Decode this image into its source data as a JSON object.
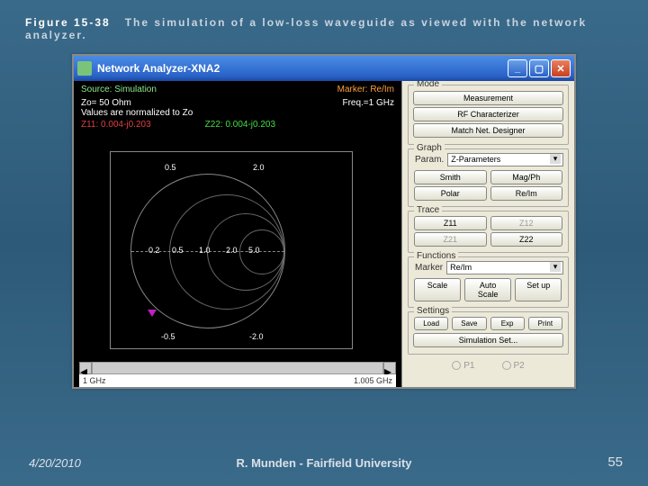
{
  "caption": {
    "num": "Figure 15-38",
    "text": "The simulation of a low-loss waveguide as viewed with the network analyzer."
  },
  "window": {
    "title": "Network Analyzer-XNA2",
    "min": "_",
    "max": "▢",
    "close": "✕"
  },
  "plot": {
    "source": "Source: Simulation",
    "marker_label": "Marker: Re/Im",
    "zo": "Zo= 50 Ohm",
    "freq": "Freq.=1 GHz",
    "normalized": "Values are normalized to Zo",
    "z11": "Z11: 0.004-j0.203",
    "z22": "Z22: 0.004-j0.203",
    "ticks": {
      "top_left": "0.5",
      "top_right": "2.0",
      "mid_02": "0.2",
      "mid_05": "0.5",
      "mid_10": "1.0",
      "mid_20": "2.0",
      "mid_50": "5.0",
      "bot_left": "-0.5",
      "bot_right": "-2.0"
    },
    "freq_start": "1 GHz",
    "freq_end": "1.005 GHz"
  },
  "panel": {
    "mode": {
      "title": "Mode",
      "measurement": "Measurement",
      "rf": "RF Characterizer",
      "match": "Match Net. Designer"
    },
    "graph": {
      "title": "Graph",
      "param_label": "Param.",
      "param_value": "Z-Parameters",
      "smith": "Smith",
      "magph": "Mag/Ph",
      "polar": "Polar",
      "reim": "Re/Im"
    },
    "trace": {
      "title": "Trace",
      "z11": "Z11",
      "z12": "Z12",
      "z21": "Z21",
      "z22": "Z22"
    },
    "functions": {
      "title": "Functions",
      "marker_label": "Marker",
      "marker_value": "Re/Im",
      "scale": "Scale",
      "auto": "Auto Scale",
      "setup": "Set up"
    },
    "settings": {
      "title": "Settings",
      "load": "Load",
      "save": "Save",
      "exp": "Exp",
      "print": "Print",
      "sim": "Simulation Set..."
    },
    "ports": {
      "p1": "P1",
      "p2": "P2"
    }
  },
  "footer": {
    "date": "4/20/2010",
    "author": "R. Munden - Fairfield University",
    "page": "55"
  },
  "chart_data": {
    "type": "smith",
    "title": "Smith chart (Z-parameters, normalized to 50 Ω)",
    "reference_impedance_ohm": 50,
    "frequency_GHz": 1.0,
    "sweep_GHz": [
      1.0,
      1.005
    ],
    "real_axis_ticks": [
      0.2,
      0.5,
      1.0,
      2.0,
      5.0
    ],
    "reactance_arc_ticks": [
      0.5,
      2.0,
      -0.5,
      -2.0
    ],
    "series": [
      {
        "name": "Z11",
        "color": "#e04040",
        "re": 0.004,
        "im": -0.203
      },
      {
        "name": "Z22",
        "color": "#40e040",
        "re": 0.004,
        "im": -0.203
      }
    ],
    "marker_mode": "Re/Im"
  }
}
